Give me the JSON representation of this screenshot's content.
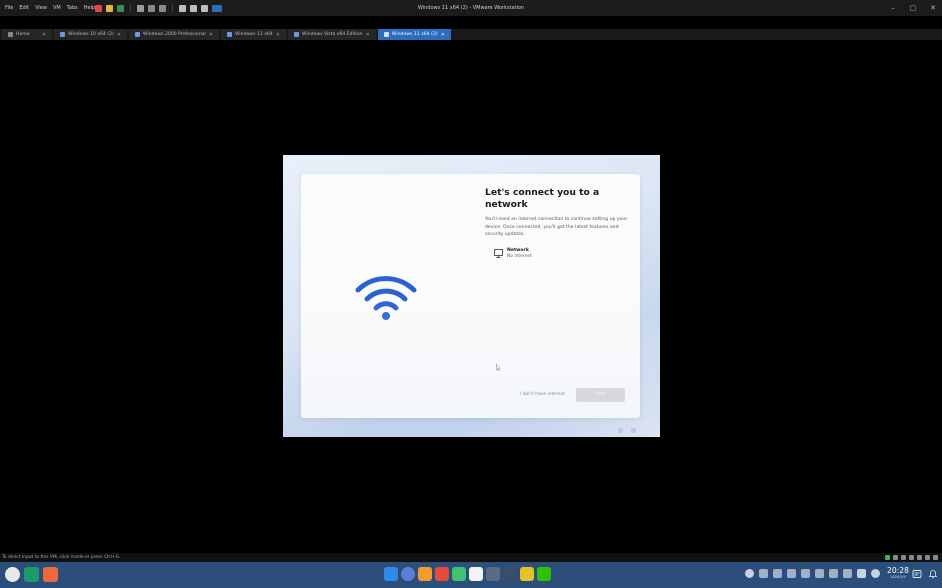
{
  "window": {
    "title": "Windows 11 x64 (2) - VMware Workstation",
    "controls": [
      "–",
      "▢",
      "✕"
    ]
  },
  "menu": [
    "File",
    "Edit",
    "View",
    "VM",
    "Tabs",
    "Help"
  ],
  "tabs": [
    {
      "label": "Home",
      "close": "✕"
    },
    {
      "label": "Windows 10 x64 (2)",
      "close": "✕"
    },
    {
      "label": "Windows 2000 Professional",
      "close": "✕"
    },
    {
      "label": "Windows 11 x64",
      "close": "✕"
    },
    {
      "label": "Windows Vista x64 Edition",
      "close": "✕"
    },
    {
      "label": "Windows 11 x64 (2)",
      "close": "✕",
      "active": true
    }
  ],
  "oobe": {
    "heading": "Let's connect you to a network",
    "description": "You'll need an internet connection to continue setting up your device. Once connected, you'll get the latest features and security updates.",
    "network": {
      "name": "Network",
      "status": "No internet"
    },
    "no_internet_link": "I don't have internet",
    "next_button": "Next",
    "accent_color": "#2b61d1"
  },
  "status_bar": {
    "text": "To direct input to this VM, click inside or press Ctrl+G."
  },
  "taskbar": {
    "time": "20:28",
    "date": "2024/1/9",
    "background_color": "#2c4e7a"
  }
}
